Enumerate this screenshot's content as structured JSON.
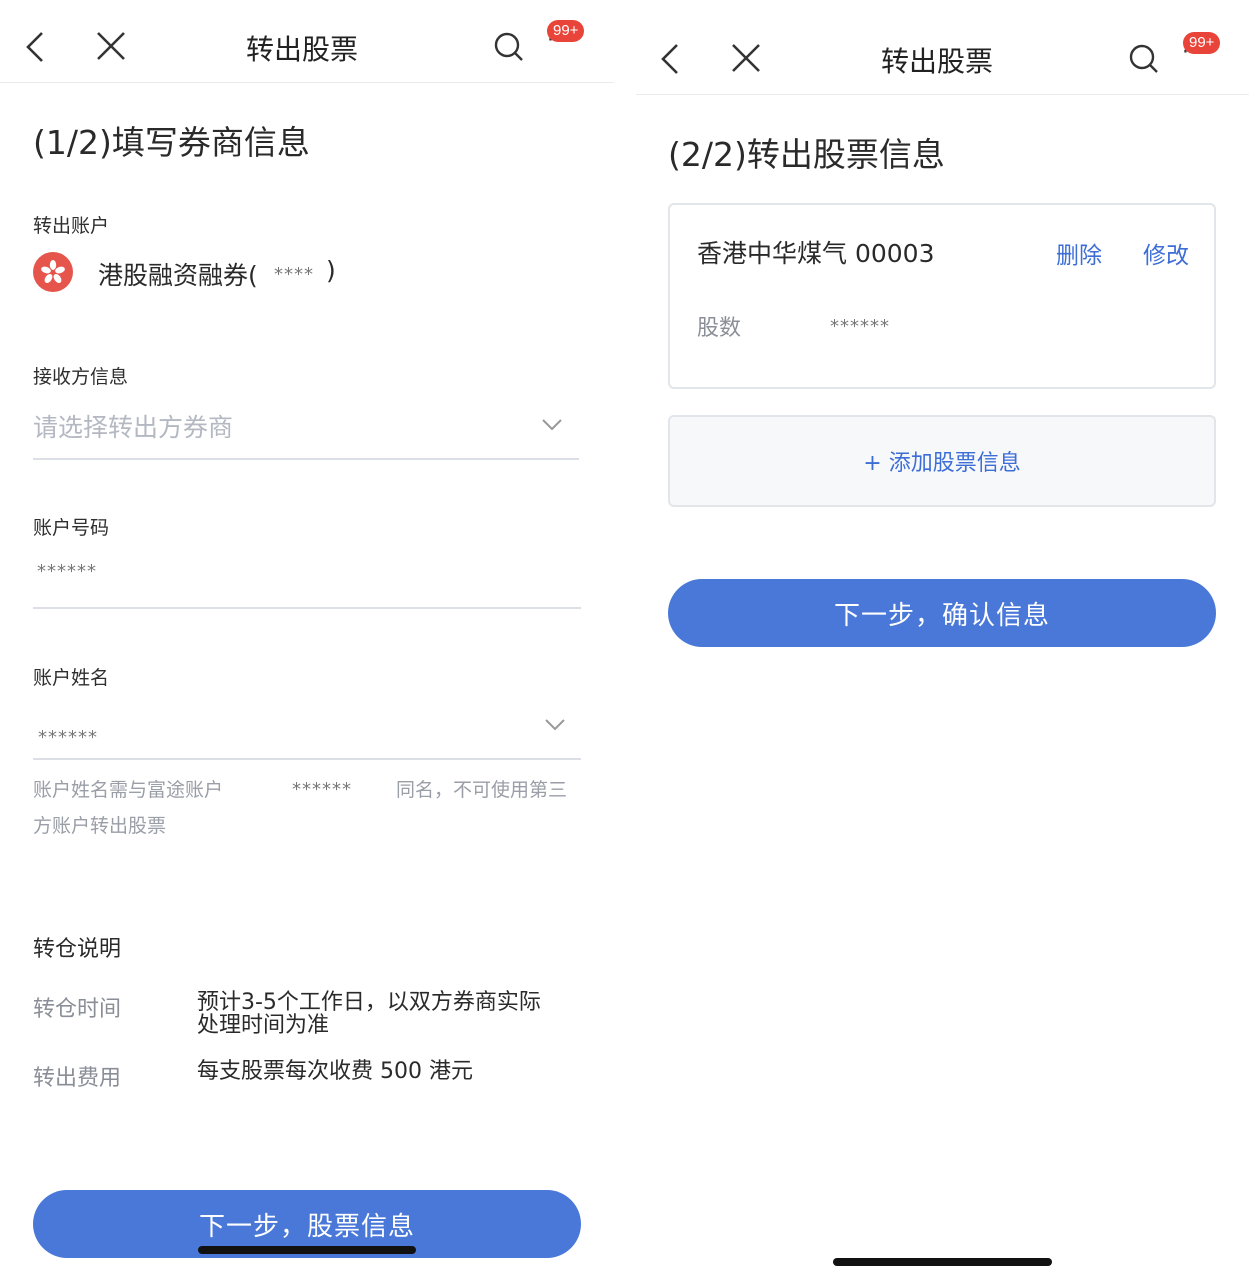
{
  "left": {
    "nav": {
      "title": "转出股票",
      "badge": "99+"
    },
    "step_title": "(1/2)填写券商信息",
    "transfer_account": {
      "label": "转出账户",
      "name": "港股融资融券(",
      "masked": "****",
      "close": ")"
    },
    "receiver": {
      "label": "接收方信息",
      "placeholder": "请选择转出方券商"
    },
    "account_number": {
      "label": "账户号码",
      "value": "******"
    },
    "account_name": {
      "label": "账户姓名",
      "value": "******",
      "hint_part1": "账户姓名需与富途账户",
      "hint_masked": "******",
      "hint_part2": "同名，不可使用第三",
      "hint_line2": "方账户转出股票"
    },
    "notes": {
      "title": "转仓说明",
      "rows": [
        {
          "key": "转仓时间",
          "line1": "预计3-5个工作日，以双方券商实际",
          "line2": "处理时间为准"
        },
        {
          "key": "转出费用",
          "line1": "每支股票每次收费 500 港元",
          "line2": ""
        }
      ]
    },
    "next_button": "下一步，股票信息"
  },
  "right": {
    "nav": {
      "title": "转出股票",
      "badge": "99+"
    },
    "step_title": "(2/2)转出股票信息",
    "stock_card": {
      "name": "香港中华煤气 00003",
      "delete": "删除",
      "edit": "修改",
      "shares_label": "股数",
      "shares_value": "******"
    },
    "add_stock": "+ 添加股票信息",
    "confirm_button": "下一步，确认信息"
  },
  "colors": {
    "primary": "#4a78d9",
    "link": "#3d6ed6",
    "badge": "#e8443a",
    "flag": "#e5554b"
  }
}
